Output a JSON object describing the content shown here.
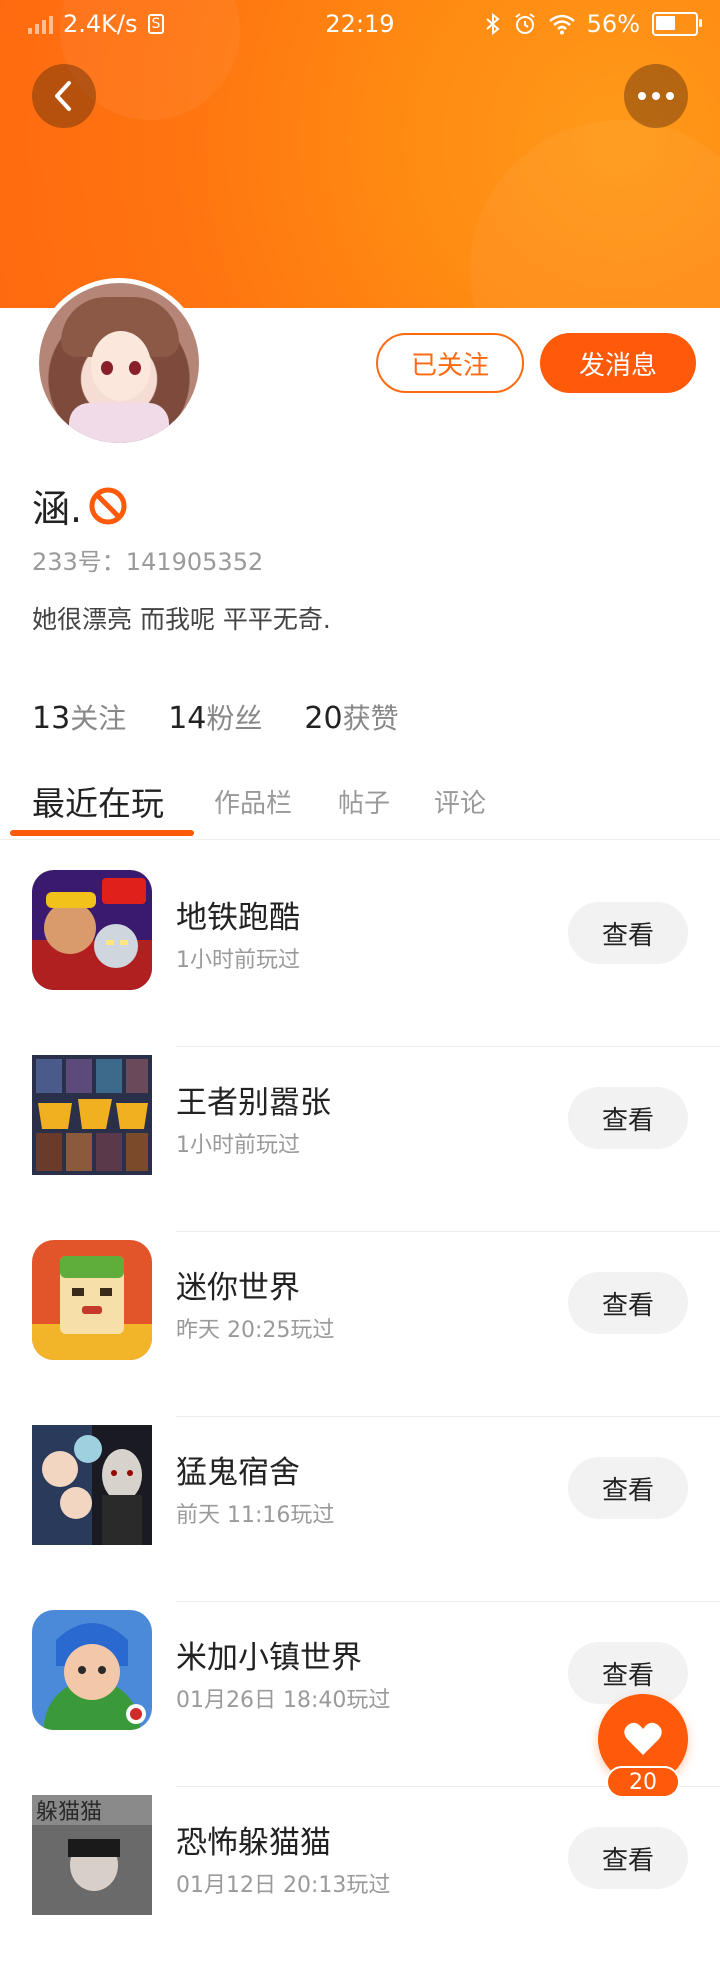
{
  "status_bar": {
    "net_speed": "2.4K/s",
    "sim_badge": "S",
    "time": "22:19",
    "battery": "56%",
    "battery_level": 0.56
  },
  "header": {
    "back_icon": "chevron-left-icon",
    "more_icon": "more-dots-icon",
    "accent_color": "#ff6a10"
  },
  "profile": {
    "name": "涵.",
    "id_line": "233号：141905352",
    "bio": "她很漂亮 而我呢 平平无奇.",
    "follow_label": "已关注",
    "message_label": "发消息"
  },
  "stats": [
    {
      "num": "13",
      "label": "关注"
    },
    {
      "num": "14",
      "label": "粉丝"
    },
    {
      "num": "20",
      "label": "获赞"
    }
  ],
  "tabs": [
    {
      "label": "最近在玩",
      "active": true
    },
    {
      "label": "作品栏",
      "active": false
    },
    {
      "label": "帖子",
      "active": false
    },
    {
      "label": "评论",
      "active": false
    }
  ],
  "games": [
    {
      "title": "地铁跑酷",
      "sub": "1小时前玩过",
      "button": "查看",
      "icon": "subway-surfers-icon"
    },
    {
      "title": "王者别嚣张",
      "sub": "1小时前玩过",
      "button": "查看",
      "icon": "5v5-game-icon"
    },
    {
      "title": "迷你世界",
      "sub": "昨天 20:25玩过",
      "button": "查看",
      "icon": "mini-world-icon"
    },
    {
      "title": "猛鬼宿舍",
      "sub": "前天 11:16玩过",
      "button": "查看",
      "icon": "ghost-dorm-icon"
    },
    {
      "title": "米加小镇世界",
      "sub": "01月26日 18:40玩过",
      "button": "查看",
      "icon": "miga-town-icon"
    },
    {
      "title": "恐怖躲猫猫",
      "sub": "01月12日 20:13玩过",
      "button": "查看",
      "icon": "horror-hide-seek-icon",
      "icon_text": "躲猫猫"
    }
  ],
  "fab": {
    "icon": "heart-icon",
    "count": "20"
  }
}
